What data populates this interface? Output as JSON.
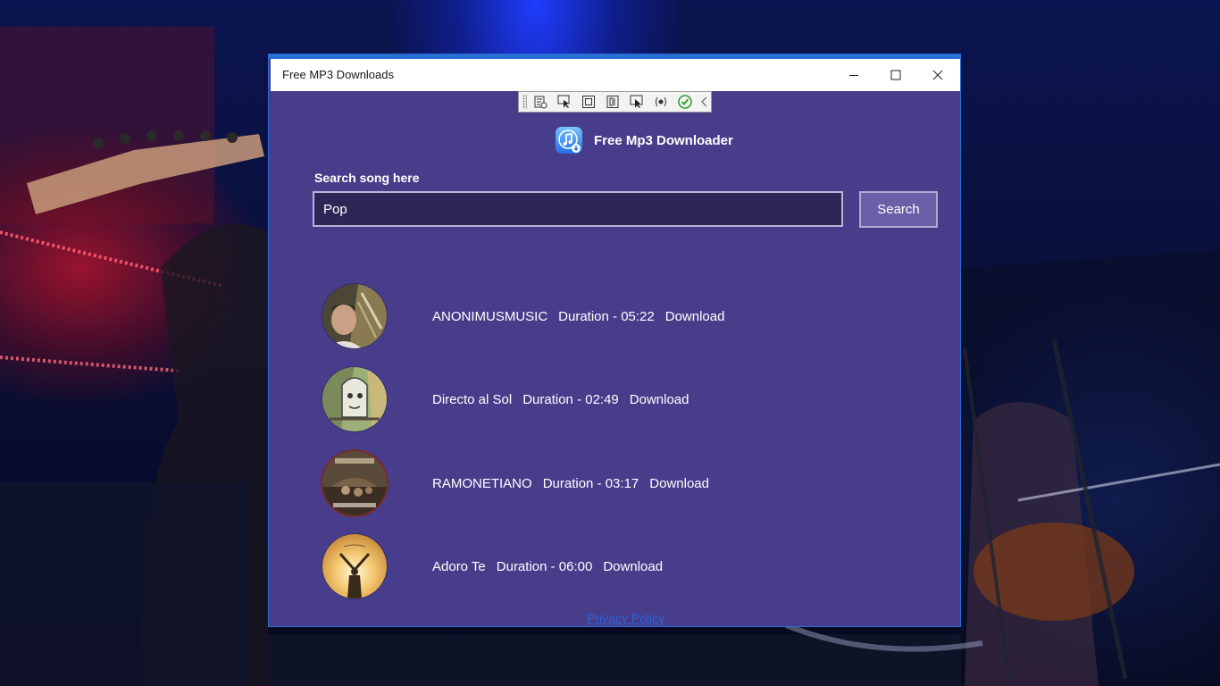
{
  "window": {
    "title": "Free MP3 Downloads"
  },
  "caption_buttons": {
    "minimize_icon": "minimize-icon",
    "maximize_icon": "maximize-icon",
    "close_icon": "close-icon"
  },
  "toolbar": {
    "icons": [
      "live-tree-icon",
      "select-element-icon",
      "layout-adorner-icon",
      "track-focus-icon",
      "display-layout-icon",
      "binding-failures-icon",
      "checkmark-icon",
      "collapse-chevron-icon"
    ]
  },
  "app": {
    "title": "Free Mp3 Downloader",
    "logo_icon": "music-download-icon"
  },
  "search": {
    "label": "Search song here",
    "value": "Pop",
    "button_label": "Search"
  },
  "tracks": [
    {
      "name": "ANONIMUSMUSIC",
      "duration": "Duration - 05:22",
      "download_label": "Download"
    },
    {
      "name": "Directo al Sol",
      "duration": "Duration - 02:49",
      "download_label": "Download"
    },
    {
      "name": "RAMONETIANO",
      "duration": "Duration - 03:17",
      "download_label": "Download"
    },
    {
      "name": "Adoro Te",
      "duration": "Duration - 06:00",
      "download_label": "Download"
    }
  ],
  "footer": {
    "privacy_label": "Privacy Policy"
  },
  "colors": {
    "app_background": "#483d8b",
    "input_background": "#2e2656",
    "button_background": "#6a60a8",
    "link": "#2c62d6",
    "window_accent": "#2a6fd6"
  }
}
